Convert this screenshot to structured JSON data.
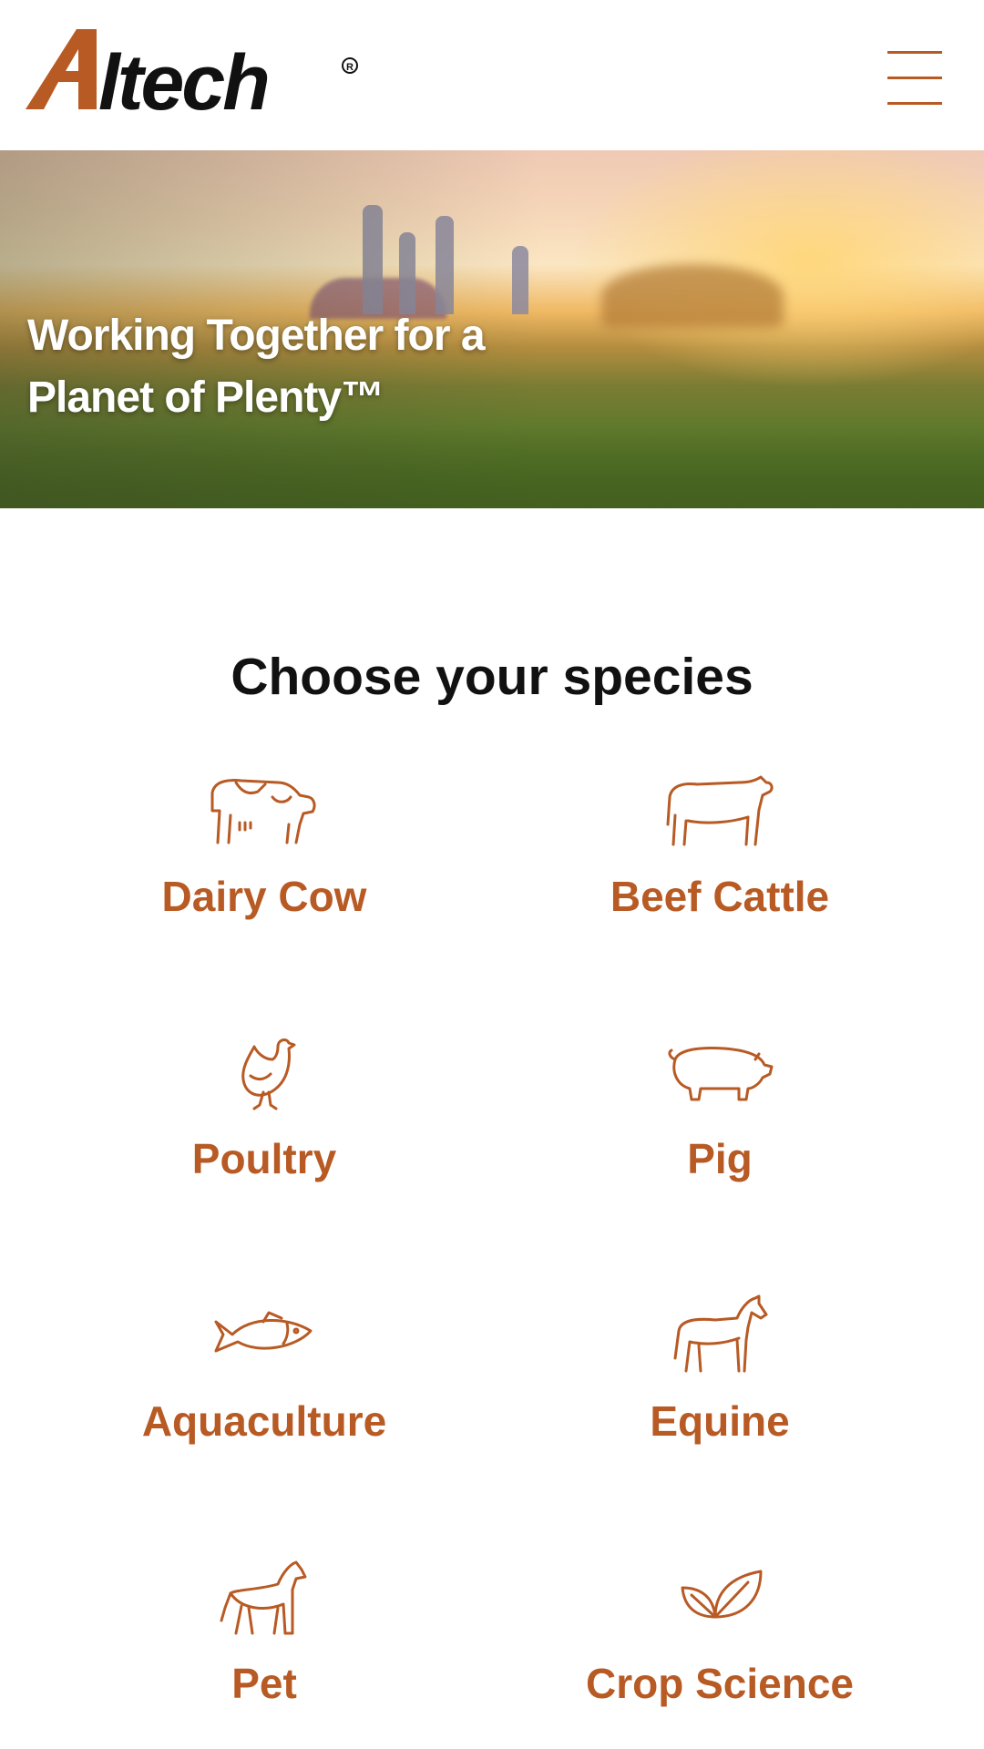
{
  "brand": {
    "name": "Alltech",
    "registered_mark": "®",
    "accent_color": "#b85a24"
  },
  "header": {
    "menu_icon": "hamburger-menu-icon"
  },
  "hero": {
    "title_line1": "Working Together for a",
    "title_line2": "Planet of Plenty™"
  },
  "species_section": {
    "title": "Choose your species",
    "items": [
      {
        "label": "Dairy Cow",
        "icon": "dairy-cow-icon"
      },
      {
        "label": "Beef Cattle",
        "icon": "beef-cattle-icon"
      },
      {
        "label": "Poultry",
        "icon": "poultry-icon"
      },
      {
        "label": "Pig",
        "icon": "pig-icon"
      },
      {
        "label": "Aquaculture",
        "icon": "fish-icon"
      },
      {
        "label": "Equine",
        "icon": "horse-icon"
      },
      {
        "label": "Pet",
        "icon": "dog-icon"
      },
      {
        "label": "Crop Science",
        "icon": "leaf-icon"
      }
    ]
  }
}
